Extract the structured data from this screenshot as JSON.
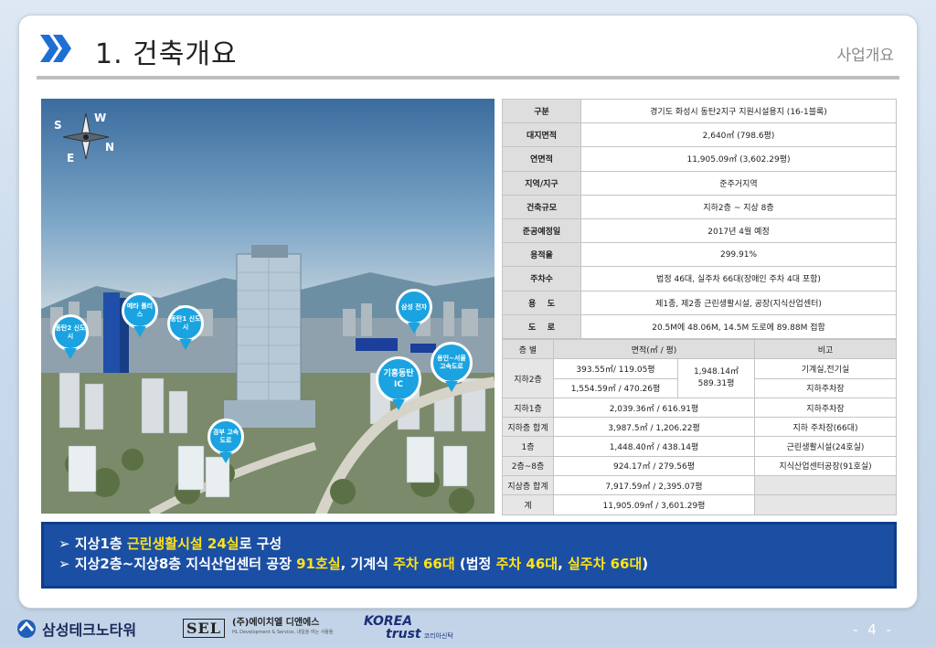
{
  "header": {
    "title": "1. 건축개요",
    "section": "사업개요"
  },
  "site_image": {
    "compass": {
      "north": "N",
      "south": "S",
      "east": "E",
      "west": "W"
    },
    "markers": [
      {
        "label": "동탄2 신도시"
      },
      {
        "label": "메타 폴리스"
      },
      {
        "label": "동탄1 신도시"
      },
      {
        "label": "삼성 전자"
      },
      {
        "label": "기흥동탄 IC"
      },
      {
        "label": "용인~서울 고속도로"
      },
      {
        "label": "경부 고속도로"
      }
    ]
  },
  "info_table": [
    {
      "label": "구분",
      "value": "경기도 화성시 동탄2지구 지원시설용지 (16-1블록)"
    },
    {
      "label": "대지면적",
      "value": "2,640㎡ (798.6평)"
    },
    {
      "label": "연면적",
      "value": "11,905.09㎡  (3,602.29평)"
    },
    {
      "label": "지역/지구",
      "value": "준주거지역"
    },
    {
      "label": "건축규모",
      "value": "지하2층 ~ 지상 8층"
    },
    {
      "label": "준공예정일",
      "value": "2017년 4월 예정"
    },
    {
      "label": "용적율",
      "value": "299.91%"
    },
    {
      "label": "주차수",
      "value": "법정 46대, 실주차 66대(장애인 주차 4대 포함)"
    },
    {
      "label": "용    도",
      "value": "제1종, 제2종 근린생활시설, 공장(지식산업센터)"
    },
    {
      "label": "도    로",
      "value": "20.5M에 48.06M, 14.5M 도로에 89.88M 접함"
    }
  ],
  "floor_table": {
    "headers": {
      "floor": "층 별",
      "area": "면적(㎡ / 평)",
      "note": "비고"
    },
    "b2": {
      "floor": "지하2층",
      "area_1": "393.55㎡/ 119.05평",
      "area_2": "1,554.59㎡ / 470.26평",
      "total_1": "1,948.14㎡",
      "total_2": "589.31평",
      "note_1": "기계실,전기실",
      "note_2": "지하주차장"
    },
    "rows": [
      {
        "floor": "지하1층",
        "area": "2,039.36㎡ / 616.91평",
        "note": "지하주차장"
      },
      {
        "floor": "지하층 합계",
        "area": "3,987.5㎡ / 1,206.22평",
        "note": "지하 주차장(66대)"
      },
      {
        "floor": "1층",
        "area": "1,448.40㎡ / 438.14평",
        "note": "근린생활시설(24호실)"
      },
      {
        "floor": "2층~8층",
        "area": "924.17㎡ / 279.56평",
        "note": "지식산업센터공장(91호실)"
      },
      {
        "floor": "지상층 합계",
        "area": "7,917.59㎡ / 2,395.07평",
        "note": ""
      },
      {
        "floor": "계",
        "area": "11,905.09㎡ / 3,601.29평",
        "note": ""
      }
    ]
  },
  "summary": {
    "line1": {
      "bullet": "➢",
      "a": "지상1층 ",
      "b": "근린생활시설 24실",
      "c": "로 구성"
    },
    "line2": {
      "bullet": "➢",
      "a": "지상2층~지상8층 지식산업센터 공장 ",
      "b": "91호실",
      "c": ", 기계식 ",
      "d": "주차 66대",
      "e": " (법정 ",
      "f": "주차 46대",
      "g": ", ",
      "h": "실주차 66대",
      "i": ")"
    }
  },
  "footer": {
    "logo1": "삼성테크노타워",
    "logo2_mark": "SEL",
    "logo2_name": "(주)에이치엘 디앤에스",
    "logo2_sub": "HL Development & Service, 내일을 여는 사람들",
    "logo3_top": "KOREA",
    "logo3_bottom": "trust",
    "logo3_sub": "코리아신탁",
    "page": "- 4 -"
  },
  "colors": {
    "accent_blue": "#1b4fa3",
    "highlight_yellow": "#ffe21a",
    "marker_blue": "#1aa3e0",
    "chevron_blue": "#1e6fd4"
  }
}
